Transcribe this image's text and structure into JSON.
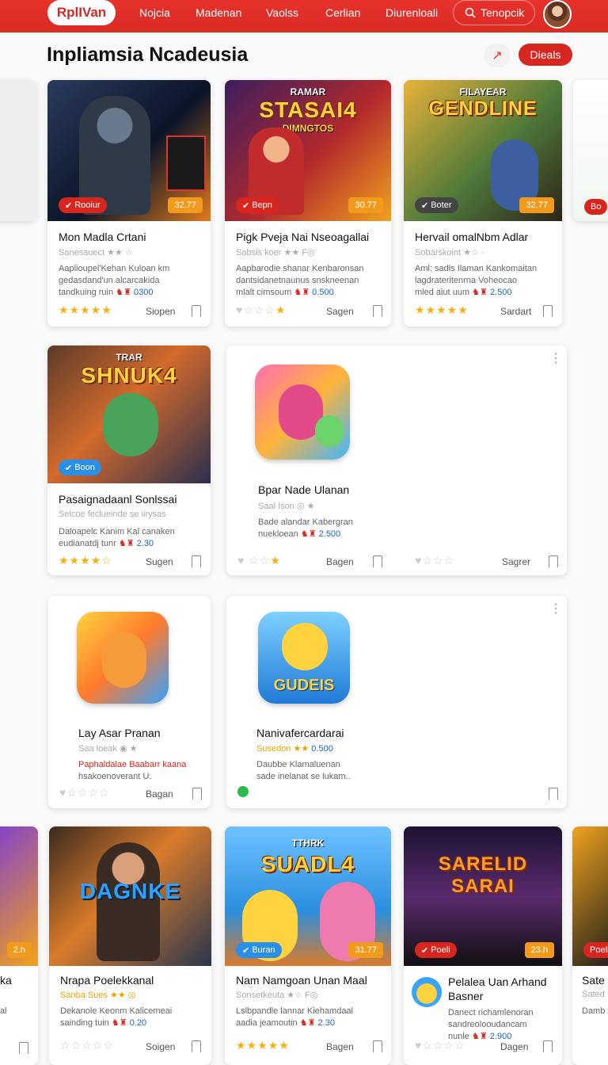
{
  "topbar": {
    "logo": "RplIVan",
    "nav": [
      "Nojcia",
      "Madenan",
      "Vaolss",
      "Cerlian",
      "Diurenloali"
    ],
    "search": "Tenopcik",
    "accent": "#d92a24"
  },
  "header": {
    "title": "Inpliamsia Ncadeusia",
    "deals": "Dieals"
  },
  "cards": [
    {
      "title": "Mon Madla Crtani",
      "sub": "Sanesauect",
      "desc1": "Aaplioupel'Kehan Kuloan km",
      "desc2": "gedasdand'un alcarcakida",
      "desc3a": "tandkuing ruin",
      "desc3b": "0300",
      "badge": "Rooiur",
      "price": "32.77",
      "action": "Siopen"
    },
    {
      "title": "Pigk Pveja Nai Nseoagallai",
      "sub": "Sabsis koer",
      "banner": "STASAI4",
      "banner_small": "RAMAR",
      "banner_sub": "DIMNGTOS",
      "desc1": "Aapbarodie shanar Kenbaronsan",
      "desc2": "dantsidanetnaunus snskneenan",
      "desc3a": "mlalt cimsoum",
      "desc3b": "0.500",
      "badge": "Bepn",
      "price": "30.77",
      "action": "Sagen"
    },
    {
      "title": "Hervail omalNbm Adlar",
      "sub": "Sobarskoint",
      "banner": "GENDLINE",
      "banner_small": "FILAYEAR",
      "desc1": "Aml: sadls Ilaman Kankomaitan",
      "desc2": "lagdrateritenrna Voheocao",
      "desc3a": "mled aiut uum",
      "desc3b": "2.500",
      "badge": "Boter",
      "price": "32.77",
      "action": "Sardart"
    },
    {
      "title": "Pasaignadaanl Sonlssai",
      "sub": "Selcoe feclueinde se iirysas",
      "banner": "SHNUK4",
      "banner_small": "TRAR",
      "desc1": "Daloapelc Kanim Kal canaken",
      "desc2": "eudianatdj tunr",
      "desc3b": "2.30",
      "badge": "Boon",
      "action": "Sugen"
    },
    {
      "title": "Bpar Nade Ulanan",
      "sub": "Saal Ison",
      "desc1": "Bade alandar Kabergran",
      "desc2": "nuekloean",
      "desc3b": "2.500",
      "action1": "Bagen",
      "action2": "Sagrer"
    },
    {
      "title": "Lay Asar Pranan",
      "sub": "Saa loeak",
      "desc1": "Paphaldalae Baabarr kaana",
      "desc2": "hsakoenoverant U.",
      "action": "Bagan"
    },
    {
      "title": "Nanivafercardarai",
      "sub": "Susedon",
      "rate": "0.500",
      "icon_text": "GUDEIS",
      "desc1": "Daubbe Klamaluenan",
      "desc2": "sade inelanat se lukam.."
    },
    {
      "title": "Nrapa Poelekkanal",
      "sub": "Sanba Sues",
      "banner": "DAGNKE",
      "desc1": "Dekanole Keonm Kalicemeai",
      "desc2": "sainding tuin",
      "desc3b": "0.20",
      "action": "Soigen"
    },
    {
      "title": "Nam Namgoan Unan Maal",
      "sub": "Sonsetkeuta",
      "banner": "SUADL4",
      "banner_small": "TTHRK",
      "desc1": "Lslbpandle lannar Kiehamdaal",
      "desc2": "aadia jeamoutin",
      "desc3b": "2.30",
      "badge": "Buran",
      "price": "31.77",
      "action": "Bagen"
    },
    {
      "title": "Pelalea Uan Arhand",
      "title2": "Basner",
      "banner": "SARELID",
      "banner2": "SARAI",
      "desc1": "Danect richamlenoran",
      "desc2": "sandreolooudancam",
      "desc3a": "nunle",
      "desc3b": "2.900",
      "badge": "Poeli",
      "price": "23.h",
      "action": "Dagen"
    }
  ],
  "edge_cards": {
    "right_top_badge": "Bo",
    "left_bottom_title": "ka",
    "left_bottom_price": "2.h",
    "left_bottom_sub": "al",
    "right_bottom_title": "Sate",
    "right_bottom_sub": "Sated",
    "right_bottom_desc": "Damb"
  }
}
